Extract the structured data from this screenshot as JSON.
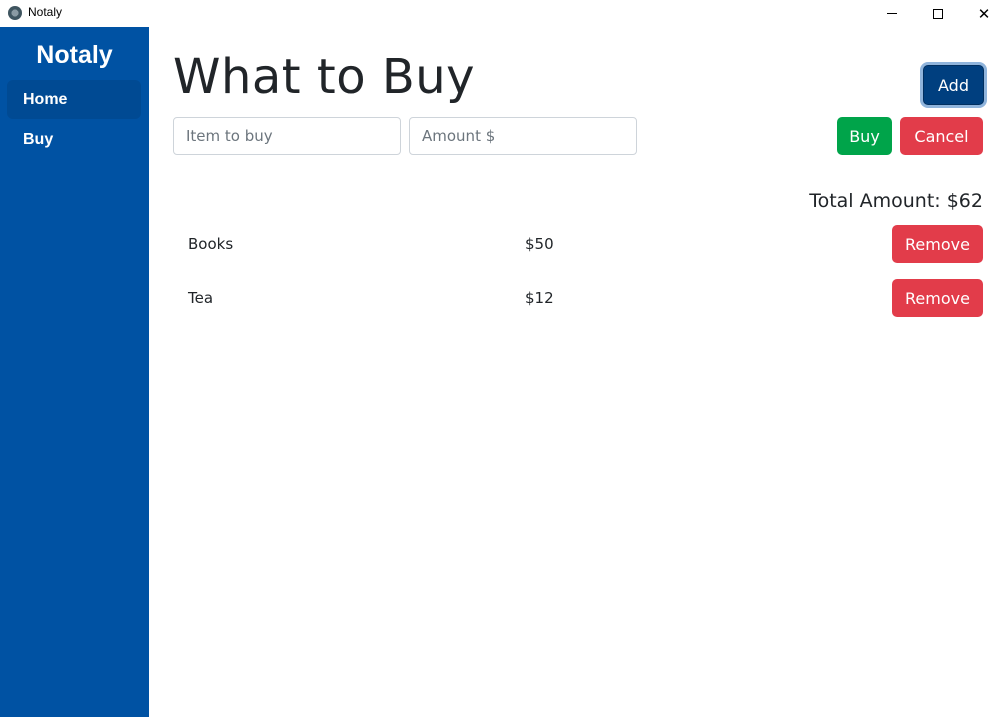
{
  "window": {
    "title": "Notaly",
    "controls": {
      "minimize_icon": "minimize-icon",
      "maximize_icon": "maximize-icon",
      "close_icon": "close-icon",
      "close_glyph": "✕"
    }
  },
  "sidebar": {
    "brand": "Notaly",
    "items": [
      {
        "label": "Home",
        "active": true
      },
      {
        "label": "Buy",
        "active": false
      }
    ]
  },
  "main": {
    "title": "What to Buy",
    "add_label": "Add",
    "form": {
      "item_placeholder": "Item to buy",
      "item_value": "",
      "amount_placeholder": "Amount $",
      "amount_value": "",
      "buy_label": "Buy",
      "cancel_label": "Cancel"
    },
    "total_label": "Total Amount: $62",
    "items": [
      {
        "name": "Books",
        "amount": "$50",
        "remove_label": "Remove"
      },
      {
        "name": "Tea",
        "amount": "$12",
        "remove_label": "Remove"
      }
    ]
  },
  "colors": {
    "sidebar": "#0052a3",
    "primary": "#003f7f",
    "success": "#00a44a",
    "danger": "#e23c4a"
  }
}
